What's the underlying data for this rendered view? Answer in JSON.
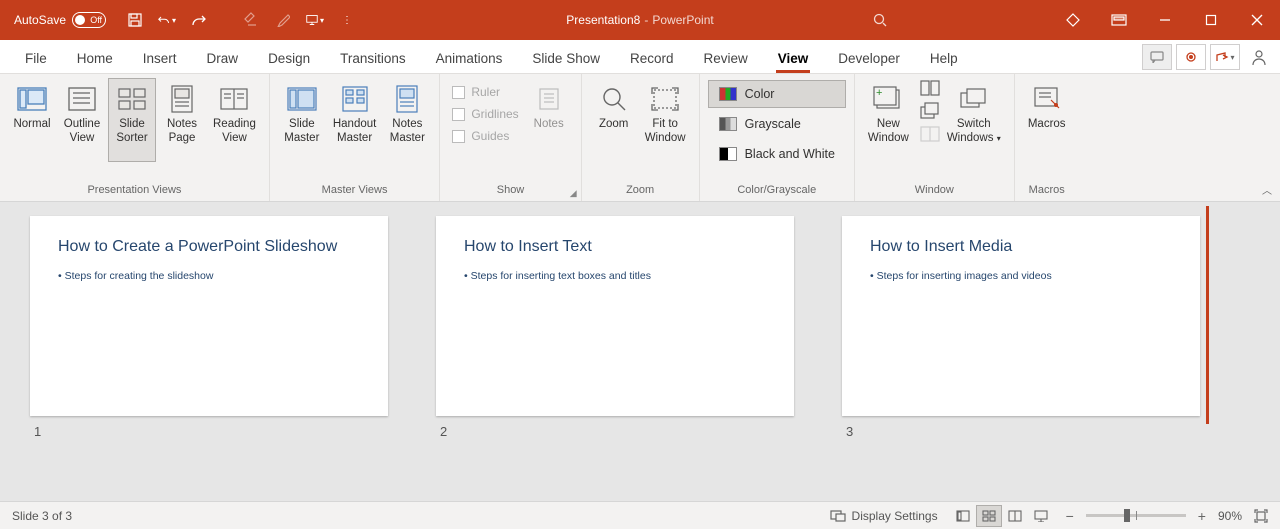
{
  "titlebar": {
    "autosave": "AutoSave",
    "autosave_state": "Off",
    "doc": "Presentation8",
    "app": "PowerPoint"
  },
  "tabs": {
    "file": "File",
    "home": "Home",
    "insert": "Insert",
    "draw": "Draw",
    "design": "Design",
    "transitions": "Transitions",
    "animations": "Animations",
    "slideshow": "Slide Show",
    "record": "Record",
    "review": "Review",
    "view": "View",
    "developer": "Developer",
    "help": "Help"
  },
  "ribbon": {
    "presentation_views": {
      "label": "Presentation Views",
      "normal": "Normal",
      "outline": "Outline\nView",
      "sorter": "Slide\nSorter",
      "notes_page": "Notes\nPage",
      "reading": "Reading\nView"
    },
    "master_views": {
      "label": "Master Views",
      "slide_master": "Slide\nMaster",
      "handout_master": "Handout\nMaster",
      "notes_master": "Notes\nMaster"
    },
    "show": {
      "label": "Show",
      "ruler": "Ruler",
      "gridlines": "Gridlines",
      "guides": "Guides",
      "notes": "Notes"
    },
    "zoom": {
      "label": "Zoom",
      "zoom_btn": "Zoom",
      "fit": "Fit to\nWindow"
    },
    "color": {
      "label": "Color/Grayscale",
      "color": "Color",
      "grayscale": "Grayscale",
      "bw": "Black and White"
    },
    "window": {
      "label": "Window",
      "new_window": "New\nWindow",
      "switch": "Switch\nWindows"
    },
    "macros": {
      "label": "Macros",
      "macros_btn": "Macros"
    }
  },
  "slides": [
    {
      "num": "1",
      "title": "How to Create a PowerPoint Slideshow",
      "bullet": "• Steps for creating the slideshow"
    },
    {
      "num": "2",
      "title": "How to Insert Text",
      "bullet": "• Steps for inserting text boxes and titles"
    },
    {
      "num": "3",
      "title": "How to Insert Media",
      "bullet": "• Steps for inserting images and videos"
    }
  ],
  "status": {
    "slide": "Slide 3 of 3",
    "display_settings": "Display Settings",
    "zoom": "90%"
  }
}
